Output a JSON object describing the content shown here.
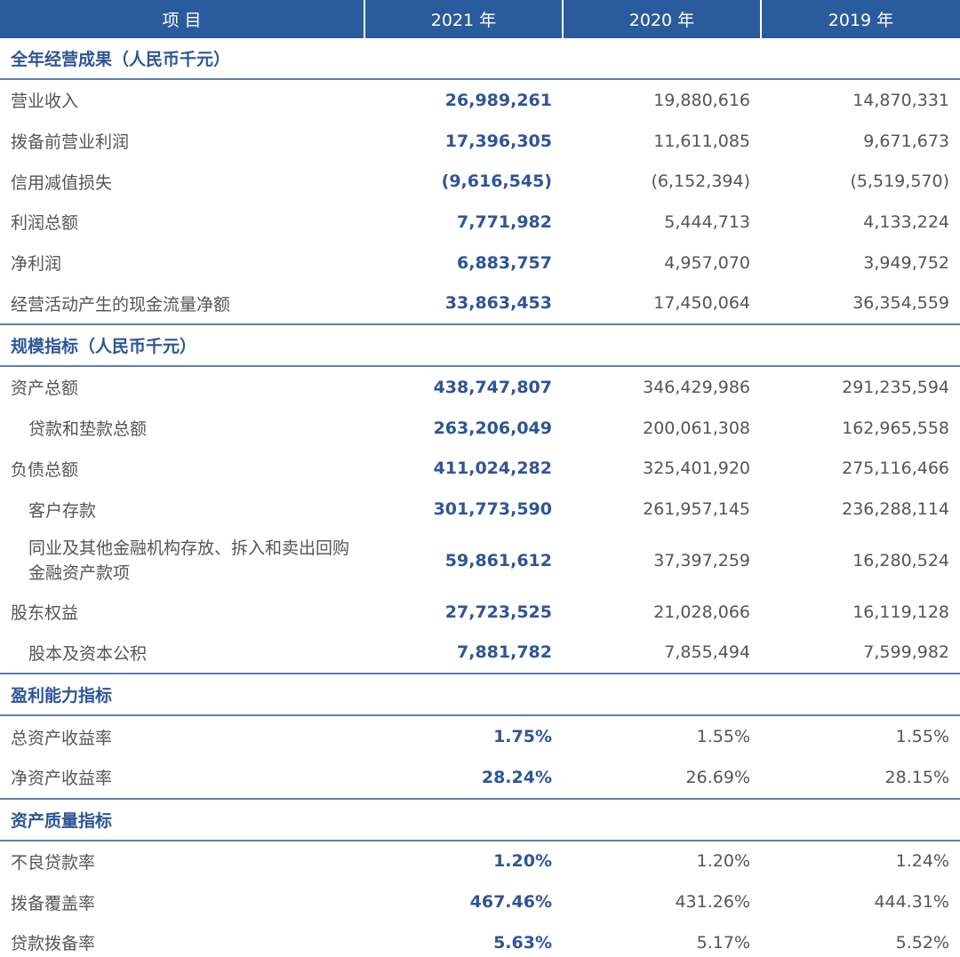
{
  "header": [
    "项 目",
    "2021 年",
    "2020 年",
    "2019 年"
  ],
  "sections": [
    {
      "title": "全年经营成果（人民币千元）",
      "rows": [
        {
          "label": "营业收入",
          "indent": false,
          "values": [
            "26,989,261",
            "19,880,616",
            "14,870,331"
          ]
        },
        {
          "label": "拨备前营业利润",
          "indent": false,
          "values": [
            "17,396,305",
            "11,611,085",
            "9,671,673"
          ]
        },
        {
          "label": "信用减值损失",
          "indent": false,
          "values": [
            "(9,616,545)",
            "(6,152,394)",
            "(5,519,570)"
          ]
        },
        {
          "label": "利润总额",
          "indent": false,
          "values": [
            "7,771,982",
            "5,444,713",
            "4,133,224"
          ]
        },
        {
          "label": "净利润",
          "indent": false,
          "values": [
            "6,883,757",
            "4,957,070",
            "3,949,752"
          ]
        },
        {
          "label": "经营活动产生的现金流量净额",
          "indent": false,
          "values": [
            "33,863,453",
            "17,450,064",
            "36,354,559"
          ]
        }
      ]
    },
    {
      "title": "规模指标（人民币千元）",
      "rows": [
        {
          "label": "资产总额",
          "indent": false,
          "values": [
            "438,747,807",
            "346,429,986",
            "291,235,594"
          ]
        },
        {
          "label": "贷款和垫款总额",
          "indent": true,
          "values": [
            "263,206,049",
            "200,061,308",
            "162,965,558"
          ]
        },
        {
          "label": "负债总额",
          "indent": false,
          "values": [
            "411,024,282",
            "325,401,920",
            "275,116,466"
          ]
        },
        {
          "label": "客户存款",
          "indent": true,
          "values": [
            "301,773,590",
            "261,957,145",
            "236,288,114"
          ]
        },
        {
          "label": "同业及其他金融机构存放、拆入和卖出回购金融资产款项",
          "indent": true,
          "multi": true,
          "values": [
            "59,861,612",
            "37,397,259",
            "16,280,524"
          ]
        },
        {
          "label": "股东权益",
          "indent": false,
          "values": [
            "27,723,525",
            "21,028,066",
            "16,119,128"
          ]
        },
        {
          "label": "股本及资本公积",
          "indent": true,
          "values": [
            "7,881,782",
            "7,855,494",
            "7,599,982"
          ]
        }
      ]
    },
    {
      "title": "盈利能力指标",
      "rows": [
        {
          "label": "总资产收益率",
          "indent": false,
          "values": [
            "1.75%",
            "1.55%",
            "1.55%"
          ]
        },
        {
          "label": "净资产收益率",
          "indent": false,
          "values": [
            "28.24%",
            "26.69%",
            "28.15%"
          ]
        }
      ]
    },
    {
      "title": "资产质量指标",
      "rows": [
        {
          "label": "不良贷款率",
          "indent": false,
          "values": [
            "1.20%",
            "1.20%",
            "1.24%"
          ]
        },
        {
          "label": "拨备覆盖率",
          "indent": false,
          "values": [
            "467.46%",
            "431.26%",
            "444.31%"
          ]
        },
        {
          "label": "贷款拨备率",
          "indent": false,
          "values": [
            "5.63%",
            "5.17%",
            "5.52%"
          ]
        }
      ]
    }
  ]
}
